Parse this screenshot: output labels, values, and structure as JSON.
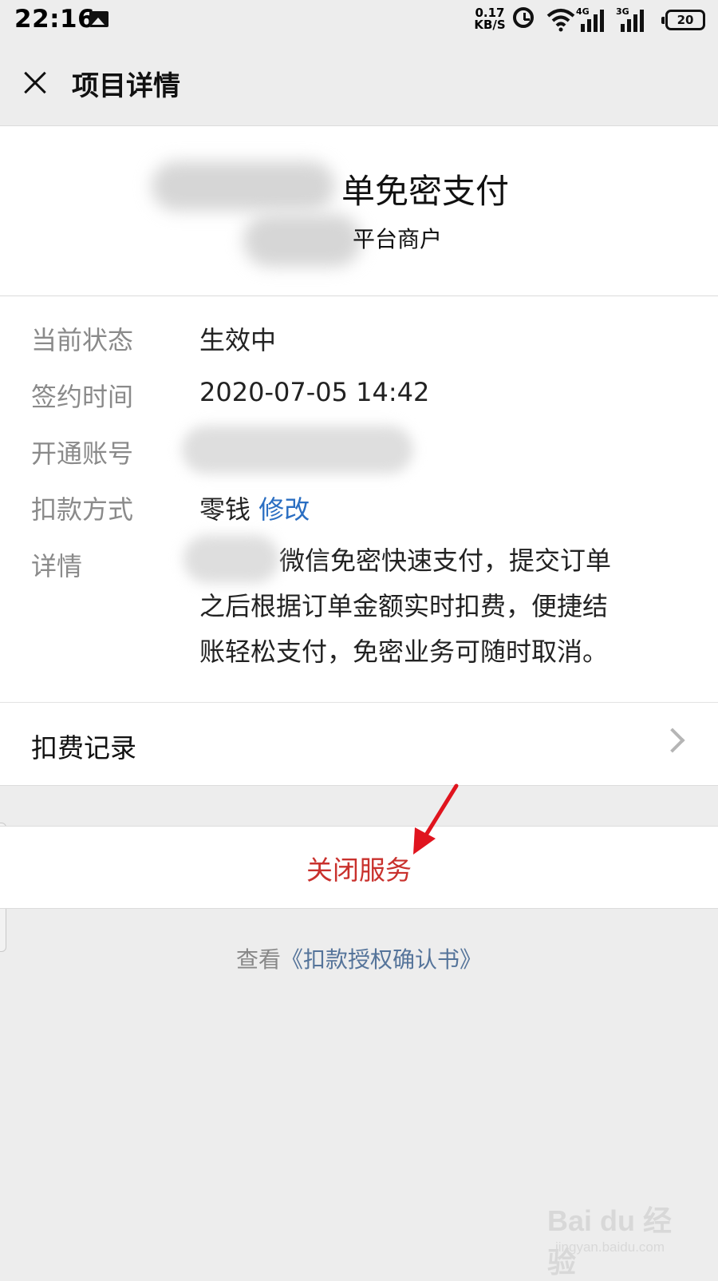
{
  "status_bar": {
    "time": "22:16",
    "speed_value": "0.17",
    "speed_unit": "KB/S",
    "net1": "4G",
    "net2": "3G",
    "battery": "20"
  },
  "nav": {
    "title": "项目详情"
  },
  "header": {
    "service_title": "单免密支付",
    "merchant_type": "平台商户"
  },
  "details": {
    "status_label": "当前状态",
    "status_value": "生效中",
    "sign_time_label": "签约时间",
    "sign_time_value": "2020-07-05 14:42",
    "account_label": "开通账号",
    "payment_method_label": "扣款方式",
    "payment_method_value": "零钱",
    "modify_link": "修改",
    "detail_label": "详情",
    "detail_line1": "微信免密快速支付，提交订单",
    "detail_line2": "之后根据订单金额实时扣费，便捷结",
    "detail_line3": "账轻松支付，免密业务可随时取消。"
  },
  "fee_record": {
    "label": "扣费记录"
  },
  "actions": {
    "close_service": "关闭服务"
  },
  "auth": {
    "prefix": "查看",
    "doc": "《扣款授权确认书》"
  },
  "watermark": {
    "top": "Bai du 经验",
    "bottom": "jingyan.baidu.com"
  },
  "colors": {
    "danger": "#c9312d",
    "link": "#2a6ec2",
    "annotation_arrow": "#e0141e"
  }
}
